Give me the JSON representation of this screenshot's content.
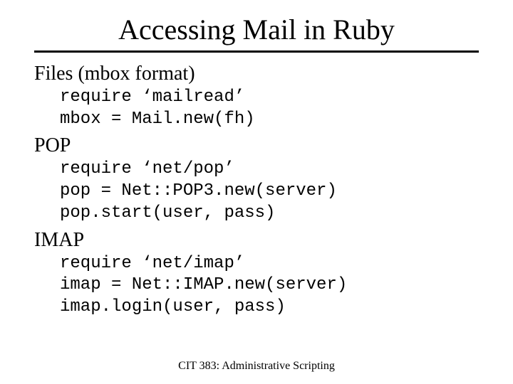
{
  "title": "Accessing Mail in Ruby",
  "sections": {
    "files": {
      "heading": "Files (mbox format)",
      "code": "require ‘mailread’\nmbox = Mail.new(fh)"
    },
    "pop": {
      "heading": "POP",
      "code": "require ‘net/pop’\npop = Net::POP3.new(server)\npop.start(user, pass)"
    },
    "imap": {
      "heading": "IMAP",
      "code": "require ‘net/imap’\nimap = Net::IMAP.new(server)\nimap.login(user, pass)"
    }
  },
  "footer": "CIT 383: Administrative Scripting"
}
